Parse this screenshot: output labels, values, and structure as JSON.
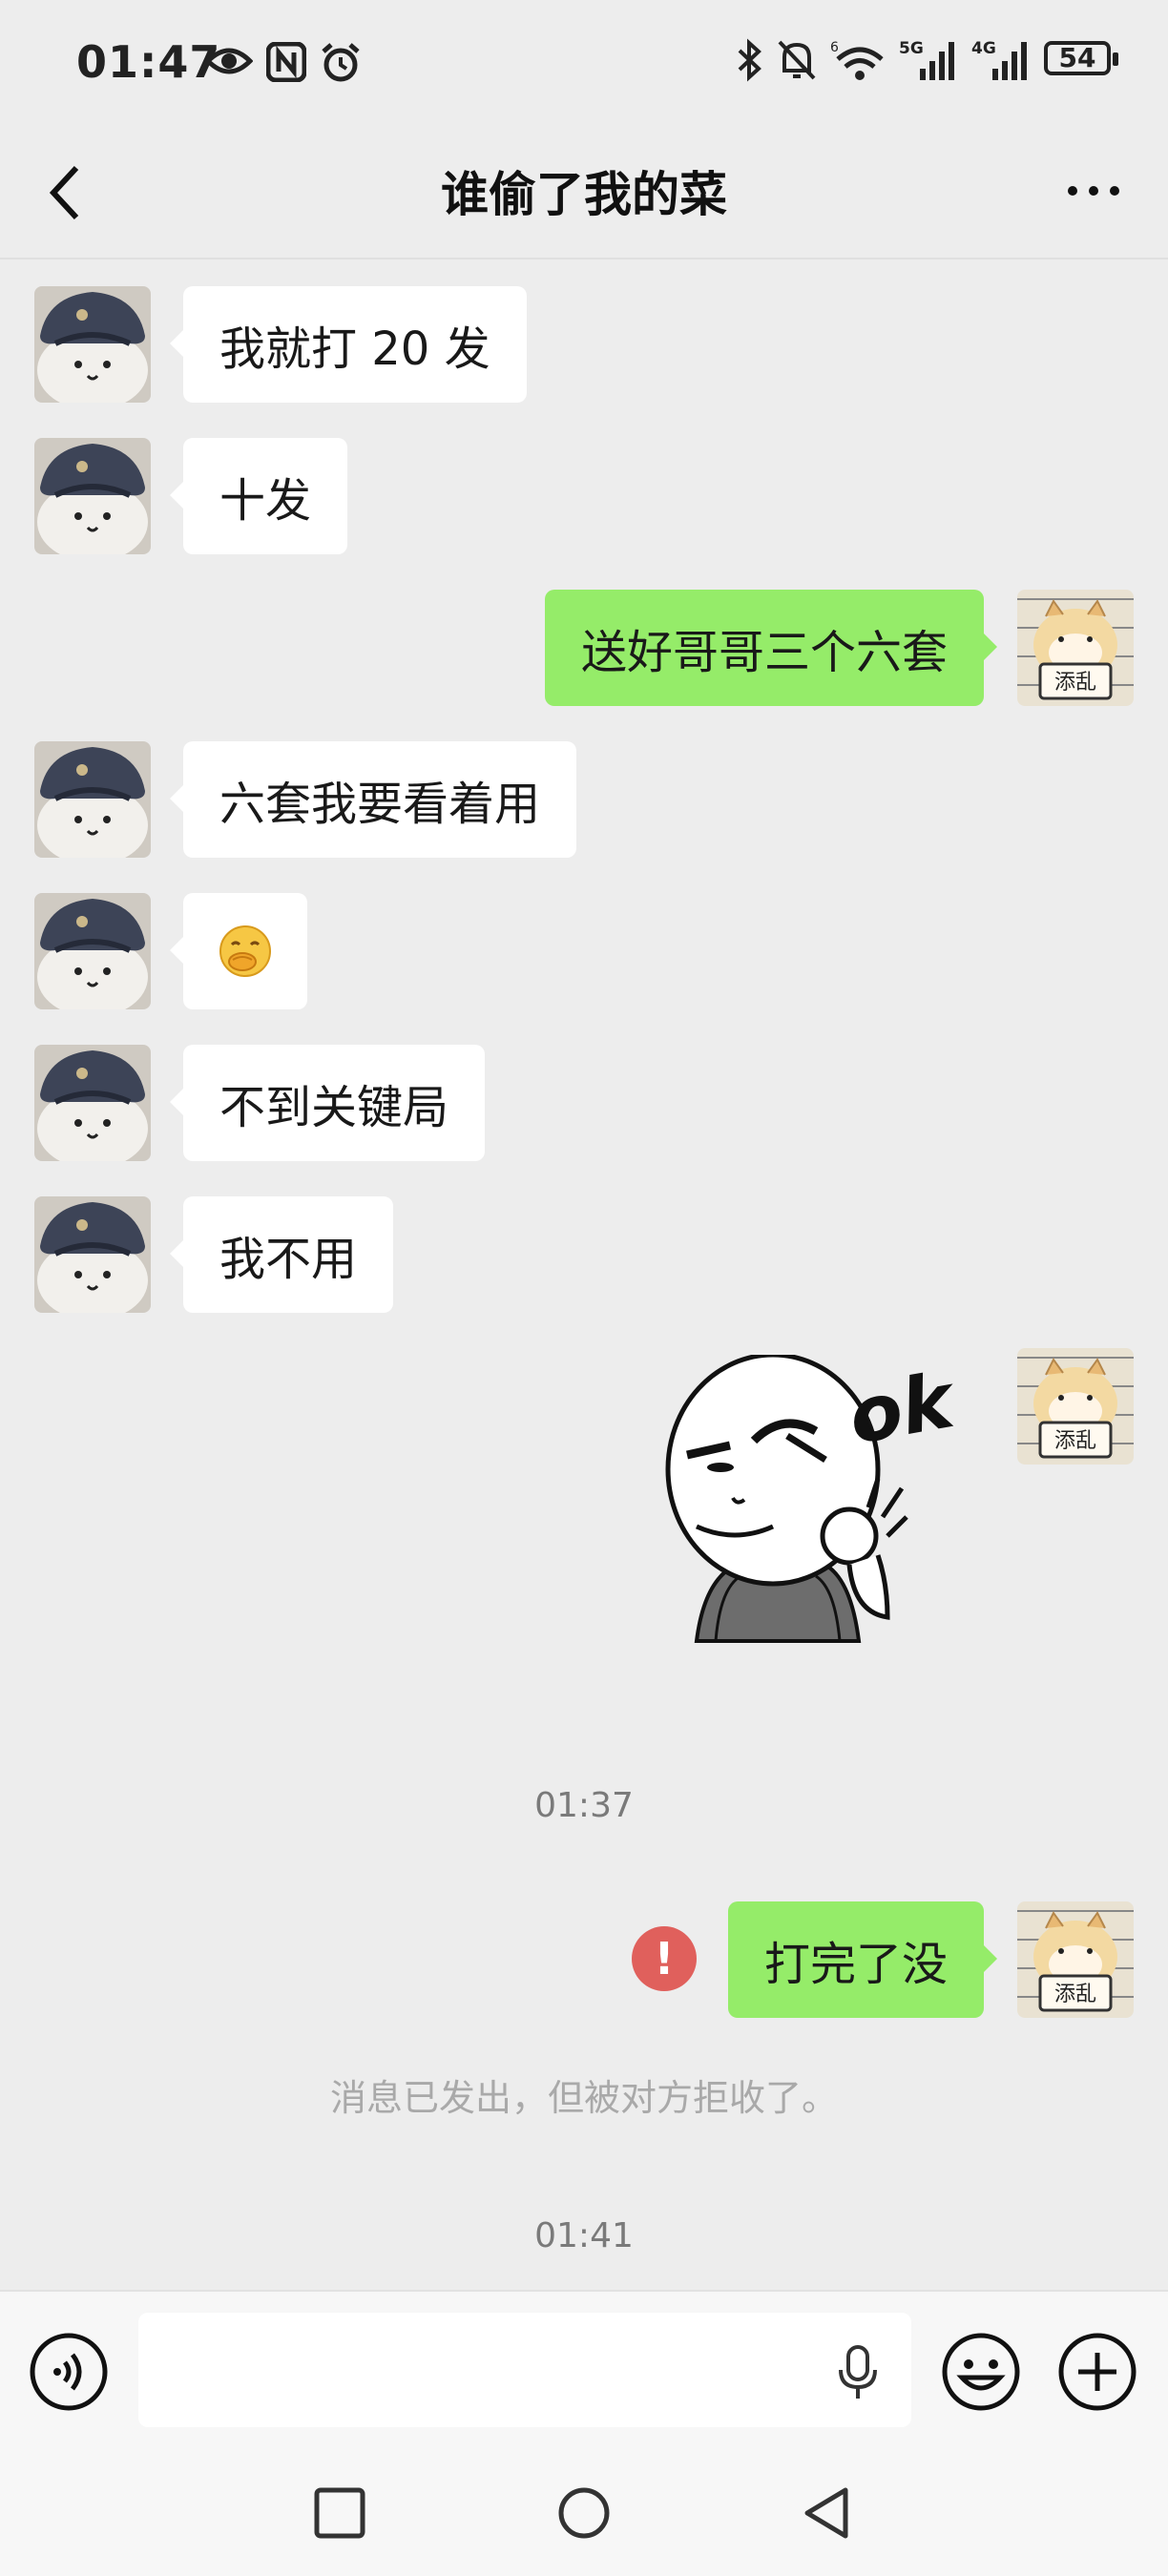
{
  "status_bar": {
    "time": "01:47",
    "battery": "54",
    "left_icons": [
      "eye-icon",
      "nfc-icon",
      "alarm-icon"
    ],
    "right_icons": [
      "bluetooth-icon",
      "mute-icon",
      "wifi-icon",
      "signal-5g-icon",
      "signal-4g-icon",
      "battery-icon"
    ]
  },
  "header": {
    "title": "谁偷了我的菜",
    "back_icon": "chevron-left-icon",
    "more_icon": "more-dots-icon"
  },
  "messages": [
    {
      "side": "in",
      "type": "text",
      "text": "我就打 20 发"
    },
    {
      "side": "in",
      "type": "text",
      "text": "十发"
    },
    {
      "side": "out",
      "type": "text",
      "text": "送好哥哥三个六套"
    },
    {
      "side": "in",
      "type": "text",
      "text": "六套我要看着用"
    },
    {
      "side": "in",
      "type": "emoji",
      "text": "🤭"
    },
    {
      "side": "in",
      "type": "text",
      "text": "不到关键局"
    },
    {
      "side": "in",
      "type": "text",
      "text": "我不用"
    },
    {
      "side": "out",
      "type": "sticker",
      "text": "ok"
    },
    {
      "type": "timestamp",
      "text": "01:37"
    },
    {
      "side": "out",
      "type": "text",
      "text": "打完了没",
      "failed": true
    },
    {
      "type": "system",
      "text": "消息已发出，但被对方拒收了。"
    },
    {
      "type": "timestamp",
      "text": "01:41"
    }
  ],
  "avatars": {
    "incoming": "bear-with-hat-avatar",
    "outgoing": "hamster-sign-avatar",
    "outgoing_sign_text": "添乱"
  },
  "error_mark": "!",
  "input_bar": {
    "voice_icon": "voice-mode-icon",
    "mic_icon": "microphone-icon",
    "emoji_icon": "emoji-icon",
    "plus_icon": "plus-icon",
    "placeholder": ""
  },
  "system_nav": [
    "recent-apps-icon",
    "home-icon",
    "back-icon"
  ],
  "colors": {
    "background": "#ededed",
    "outgoing_bubble": "#95ec69",
    "incoming_bubble": "#ffffff",
    "error": "#e0605c"
  }
}
